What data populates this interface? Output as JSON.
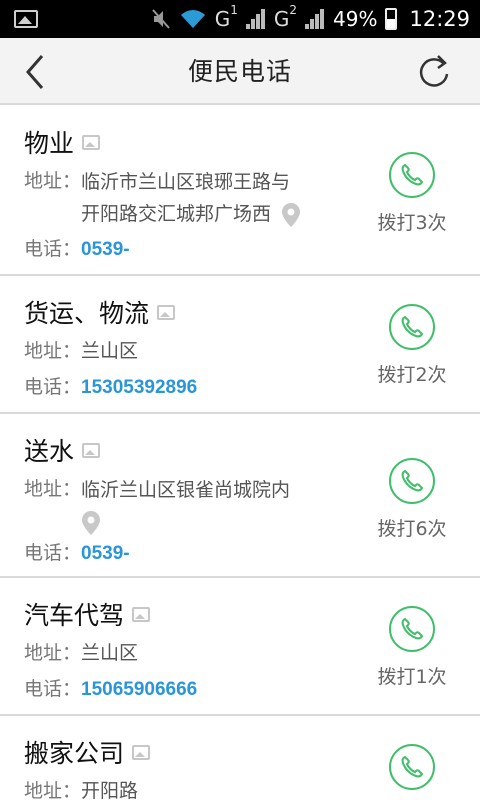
{
  "status_bar": {
    "network_1": "G",
    "sim_1": "1",
    "network_2": "G",
    "sim_2": "2",
    "battery": "49%",
    "time": "12:29"
  },
  "header": {
    "title": "便民电话",
    "back_icon": "chevron-left-icon",
    "refresh_icon": "refresh-icon"
  },
  "labels": {
    "address": "地址：",
    "phone": "电话："
  },
  "colors": {
    "accent_green": "#3fbf6a",
    "phone_blue": "#2a95d8"
  },
  "items": [
    {
      "name": "物业",
      "address_line1": "临沂市兰山区琅琊王路与",
      "address_line2": "开阳路交汇城邦广场西",
      "phone": "0539-",
      "call_count": "拨打3次"
    },
    {
      "name": "货运、物流",
      "address_line1": "兰山区",
      "phone": "15305392896",
      "call_count": "拨打2次"
    },
    {
      "name": "送水",
      "address_line1": "临沂兰山区银雀尚城院内",
      "phone": "0539-",
      "call_count": "拨打6次"
    },
    {
      "name": "汽车代驾",
      "address_line1": "兰山区",
      "phone": "15065906666",
      "call_count": "拨打1次"
    },
    {
      "name": "搬家公司",
      "address_line1": "开阳路"
    }
  ]
}
